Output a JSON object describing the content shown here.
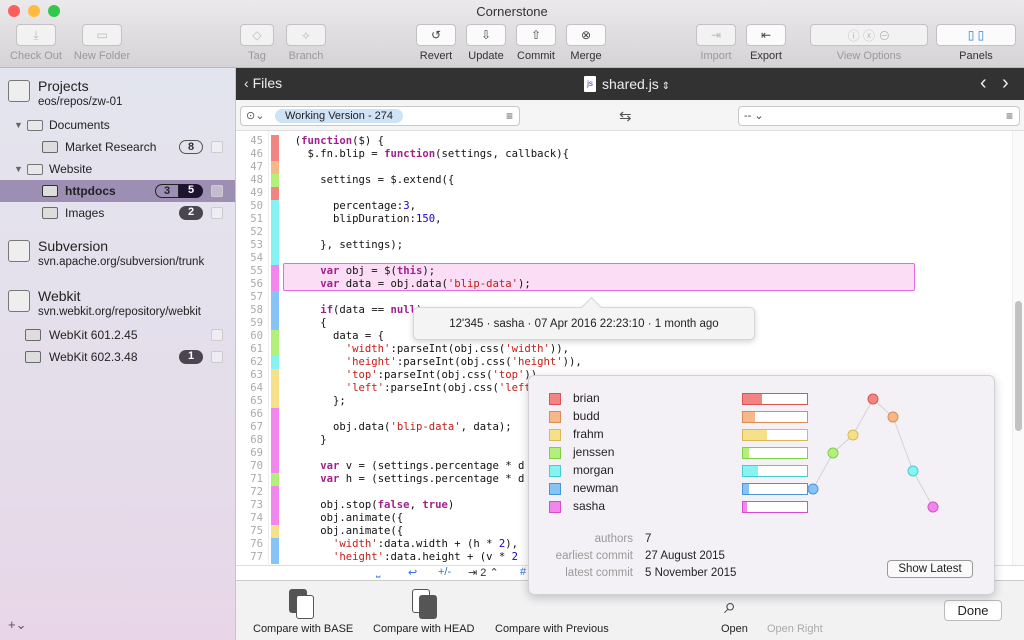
{
  "window": {
    "title": "Cornerstone"
  },
  "toolbar": [
    {
      "label": "Check Out",
      "icon": "checkout-icon",
      "enabled": false
    },
    {
      "label": "New Folder",
      "icon": "new-folder-icon",
      "enabled": false
    },
    {
      "label": "Tag",
      "icon": "tag-icon",
      "enabled": false
    },
    {
      "label": "Branch",
      "icon": "branch-icon",
      "enabled": false
    },
    {
      "label": "Revert",
      "icon": "revert-icon",
      "enabled": true
    },
    {
      "label": "Update",
      "icon": "update-icon",
      "enabled": true
    },
    {
      "label": "Commit",
      "icon": "commit-icon",
      "enabled": true
    },
    {
      "label": "Merge",
      "icon": "merge-icon",
      "enabled": true
    },
    {
      "label": "Import",
      "icon": "import-icon",
      "enabled": false
    },
    {
      "label": "Export",
      "icon": "export-icon",
      "enabled": true
    },
    {
      "label": "View Options",
      "icon": "view-options-icon",
      "enabled": false
    },
    {
      "label": "Panels",
      "icon": "panels-icon",
      "enabled": true
    }
  ],
  "sidebar": {
    "projects": [
      {
        "name": "Projects",
        "url": "eos/repos/zw-01"
      },
      {
        "name": "Subversion",
        "url": "svn.apache.org/subversion/trunk"
      },
      {
        "name": "Webkit",
        "url": "svn.webkit.org/repository/webkit"
      }
    ],
    "items": [
      {
        "label": "Documents",
        "type": "folder"
      },
      {
        "label": "Market Research",
        "type": "working-copy",
        "badge": "8"
      },
      {
        "label": "Website",
        "type": "folder"
      },
      {
        "label": "httpdocs",
        "type": "working-copy",
        "badge_left": "3",
        "badge_right": "5",
        "selected": true
      },
      {
        "label": "Images",
        "type": "working-copy",
        "badge": "2"
      },
      {
        "label": "WebKit 601.2.45",
        "type": "working-copy"
      },
      {
        "label": "WebKit 602.3.48",
        "type": "working-copy",
        "badge": "1"
      }
    ],
    "add_label": "+⌄"
  },
  "nav": {
    "back_label": "Files",
    "file_name": "shared.js"
  },
  "version_bar": {
    "left_version": "Working Version - 274",
    "right_version": "-- ⌄"
  },
  "editor": {
    "lines": [
      {
        "n": 45,
        "a": "brian",
        "t": "  (function($) {"
      },
      {
        "n": 46,
        "a": "brian",
        "t": "    $.fn.blip = function(settings, callback){"
      },
      {
        "n": 47,
        "a": "budd",
        "t": ""
      },
      {
        "n": 48,
        "a": "jenssen",
        "t": "      settings = $.extend({"
      },
      {
        "n": 49,
        "a": "brian",
        "t": ""
      },
      {
        "n": 50,
        "a": "morgan",
        "t": "        percentage:3,"
      },
      {
        "n": 51,
        "a": "morgan",
        "t": "        blipDuration:150,"
      },
      {
        "n": 52,
        "a": "morgan",
        "t": ""
      },
      {
        "n": 53,
        "a": "morgan",
        "t": "      }, settings);"
      },
      {
        "n": 54,
        "a": "morgan",
        "t": ""
      },
      {
        "n": 55,
        "a": "sasha",
        "t": "      var obj = $(this);"
      },
      {
        "n": 56,
        "a": "sasha",
        "t": "      var data = obj.data('blip-data');"
      },
      {
        "n": 57,
        "a": "newman",
        "t": ""
      },
      {
        "n": 58,
        "a": "newman",
        "t": "      if(data == null)"
      },
      {
        "n": 59,
        "a": "newman",
        "t": "      {"
      },
      {
        "n": 60,
        "a": "jenssen",
        "t": "        data = {"
      },
      {
        "n": 61,
        "a": "jenssen",
        "t": "          'width':parseInt(obj.css('width')),"
      },
      {
        "n": 62,
        "a": "morgan",
        "t": "          'height':parseInt(obj.css('height')),"
      },
      {
        "n": 63,
        "a": "frahm",
        "t": "          'top':parseInt(obj.css('top')),"
      },
      {
        "n": 64,
        "a": "frahm",
        "t": "          'left':parseInt(obj.css('left'))"
      },
      {
        "n": 65,
        "a": "frahm",
        "t": "        };"
      },
      {
        "n": 66,
        "a": "sasha",
        "t": ""
      },
      {
        "n": 67,
        "a": "sasha",
        "t": "        obj.data('blip-data', data);"
      },
      {
        "n": 68,
        "a": "sasha",
        "t": "      }"
      },
      {
        "n": 69,
        "a": "sasha",
        "t": ""
      },
      {
        "n": 70,
        "a": "sasha",
        "t": "      var v = (settings.percentage * d"
      },
      {
        "n": 71,
        "a": "jenssen",
        "t": "      var h = (settings.percentage * d"
      },
      {
        "n": 72,
        "a": "sasha",
        "t": ""
      },
      {
        "n": 73,
        "a": "sasha",
        "t": "      obj.stop(false, true)"
      },
      {
        "n": 74,
        "a": "sasha",
        "t": "      obj.animate({"
      },
      {
        "n": 75,
        "a": "frahm",
        "t": "      obj.animate({"
      },
      {
        "n": 76,
        "a": "newman",
        "t": "        'width':data.width + (h * 2),"
      },
      {
        "n": 77,
        "a": "newman",
        "t": "        'height':data.height + (v * 2"
      }
    ],
    "tooltip": "12'345 · sasha · 07 Apr 2016 22:23:10 · 1 month ago",
    "status": {
      "invisibles": "⎵",
      "wrap": "↩",
      "diff": "+/-",
      "tab_label": "⇥ 2 ⌃",
      "hash": "#"
    }
  },
  "blame_stats": {
    "authors": [
      {
        "name": "brian",
        "color": "#f28482",
        "border": "#d95555",
        "share": 0.29
      },
      {
        "name": "budd",
        "color": "#f6b886",
        "border": "#d98c55",
        "share": 0.19
      },
      {
        "name": "frahm",
        "color": "#f6e08a",
        "border": "#d9b955",
        "share": 0.38
      },
      {
        "name": "jenssen",
        "color": "#b2f07a",
        "border": "#7fcf4a",
        "share": 0.1
      },
      {
        "name": "morgan",
        "color": "#86f3f3",
        "border": "#4ccccc",
        "share": 0.23
      },
      {
        "name": "newman",
        "color": "#86c3f6",
        "border": "#4a95d6",
        "share": 0.1
      },
      {
        "name": "sasha",
        "color": "#f286ee",
        "border": "#d44fd0",
        "share": 0.07
      }
    ],
    "commit_order": [
      "newman",
      "jenssen",
      "frahm",
      "brian",
      "budd",
      "morgan",
      "sasha"
    ],
    "authors_label": "authors",
    "authors_value": "7",
    "earliest_label": "earliest commit",
    "earliest_value": "27 August 2015",
    "latest_label": "latest commit",
    "latest_value": "5 November 2015",
    "show_latest_label": "Show Latest"
  },
  "bottom": {
    "compare_base": "Compare with BASE",
    "compare_head": "Compare with HEAD",
    "compare_previous": "Compare with Previous",
    "open": "Open",
    "open_right": "Open Right",
    "done": "Done"
  }
}
